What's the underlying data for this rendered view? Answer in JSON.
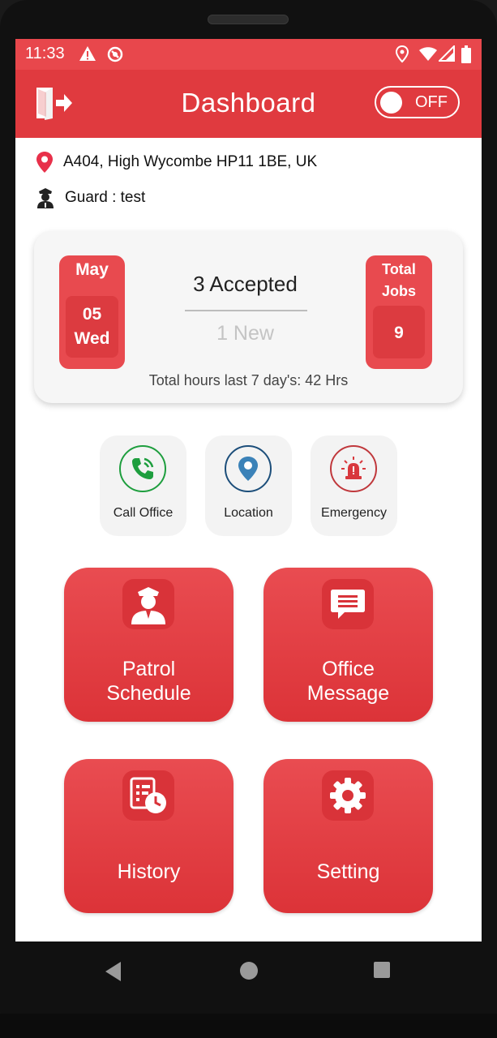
{
  "status_bar": {
    "time": "11:33",
    "icons": [
      "warning-icon",
      "sync-icon",
      "location-icon",
      "wifi-icon",
      "signal-icon",
      "battery-icon"
    ]
  },
  "header": {
    "title": "Dashboard",
    "logout_icon": "logout-icon",
    "duty_toggle": {
      "label": "OFF",
      "state": "off"
    }
  },
  "info": {
    "address": "A404, High Wycombe HP11 1BE, UK",
    "guard": "Guard : test"
  },
  "summary_card": {
    "month": "May",
    "day_num": "05",
    "weekday": "Wed",
    "accepted": "3 Accepted",
    "new_jobs": "1 New",
    "total_jobs_label_1": "Total",
    "total_jobs_label_2": "Jobs",
    "total_jobs_value": "9",
    "hours": "Total hours last 7 day's: 42 Hrs"
  },
  "quick_actions": [
    {
      "label": "Call Office",
      "icon": "phone-icon",
      "color": "#1e9e3e"
    },
    {
      "label": "Location",
      "icon": "map-pin-icon",
      "color": "#1c4e7a"
    },
    {
      "label": "Emergency",
      "icon": "siren-icon",
      "color": "#c0383c"
    }
  ],
  "tiles": [
    {
      "line1": "Patrol",
      "line2": "Schedule",
      "icon": "guard-icon"
    },
    {
      "line1": "Office",
      "line2": "Message",
      "icon": "message-icon"
    },
    {
      "line1": "History",
      "icon": "history-icon"
    },
    {
      "line1": "Setting",
      "icon": "gear-icon"
    }
  ],
  "colors": {
    "primary": "#e03a3f",
    "status_bar": "#e8474c",
    "card_bg": "#f6f6f6"
  }
}
